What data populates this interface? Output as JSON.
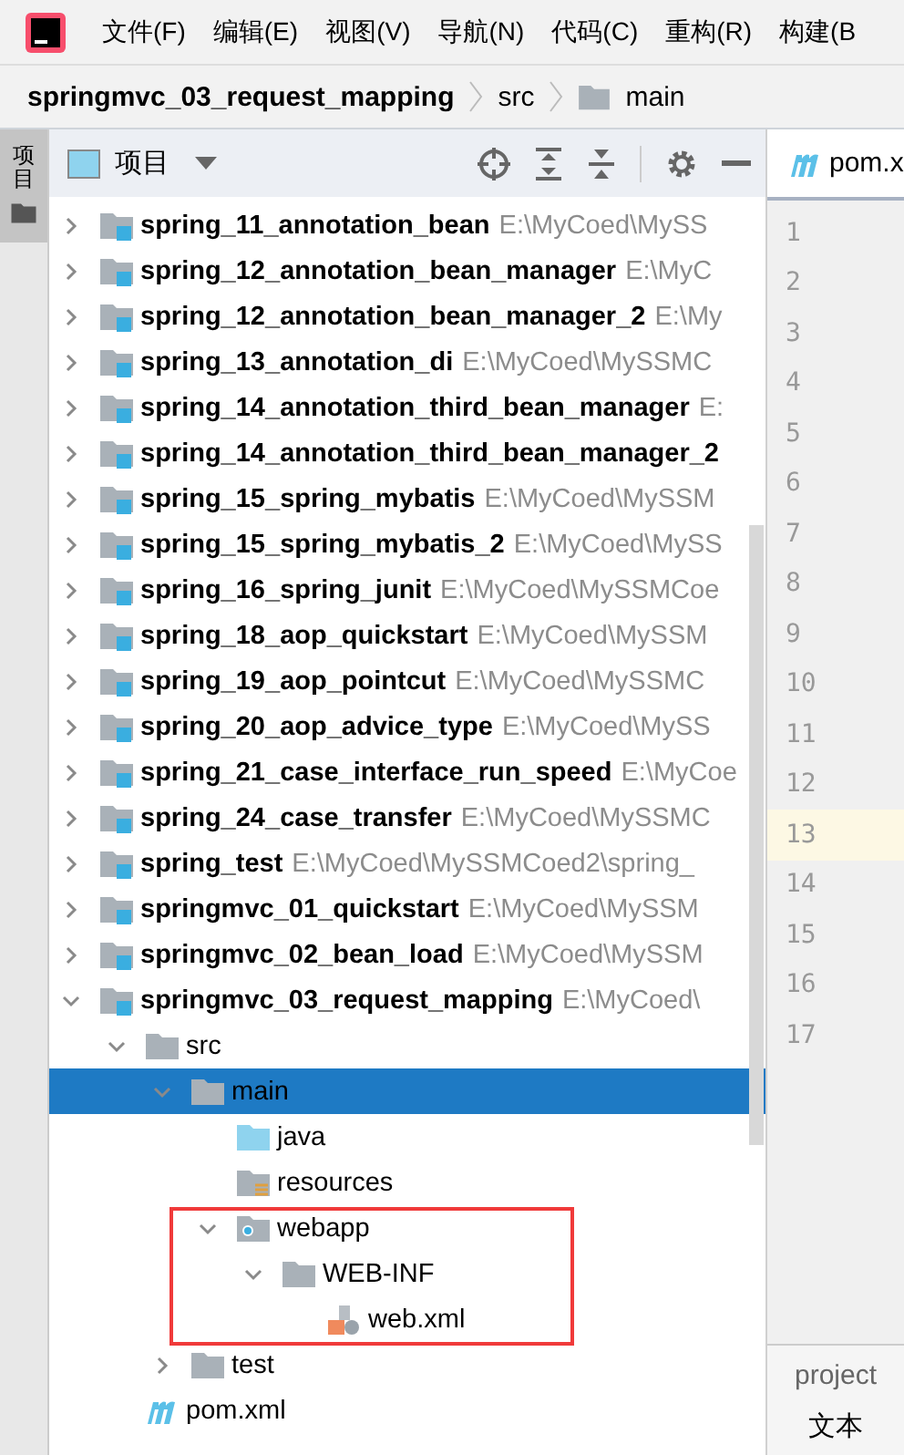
{
  "menu_bar": {
    "items": [
      "文件(F)",
      "编辑(E)",
      "视图(V)",
      "导航(N)",
      "代码(C)",
      "重构(R)",
      "构建(B"
    ]
  },
  "breadcrumb": [
    {
      "label": "springmvc_03_request_mapping",
      "kind": "project"
    },
    {
      "label": "src",
      "kind": "plain"
    },
    {
      "label": "main",
      "kind": "folder"
    }
  ],
  "side_stripe": {
    "label": "项目",
    "selected": true
  },
  "project_panel": {
    "title": "项目",
    "tree": [
      {
        "label": "spring_11_annotation_bean",
        "path": "E:\\MyCoed\\MySS",
        "kind": "module",
        "expanded": false
      },
      {
        "label": "spring_12_annotation_bean_manager",
        "path": "E:\\MyC",
        "kind": "module",
        "expanded": false
      },
      {
        "label": "spring_12_annotation_bean_manager_2",
        "path": "E:\\My",
        "kind": "module",
        "expanded": false
      },
      {
        "label": "spring_13_annotation_di",
        "path": "E:\\MyCoed\\MySSMC",
        "kind": "module",
        "expanded": false
      },
      {
        "label": "spring_14_annotation_third_bean_manager",
        "path": "E:",
        "kind": "module",
        "expanded": false
      },
      {
        "label": "spring_14_annotation_third_bean_manager_2",
        "kind": "module",
        "expanded": false
      },
      {
        "label": "spring_15_spring_mybatis",
        "path": "E:\\MyCoed\\MySSM",
        "kind": "module",
        "expanded": false
      },
      {
        "label": "spring_15_spring_mybatis_2",
        "path": "E:\\MyCoed\\MySS",
        "kind": "module",
        "expanded": false
      },
      {
        "label": "spring_16_spring_junit",
        "path": "E:\\MyCoed\\MySSMCoe",
        "kind": "module",
        "expanded": false
      },
      {
        "label": "spring_18_aop_quickstart",
        "path": "E:\\MyCoed\\MySSM",
        "kind": "module",
        "expanded": false
      },
      {
        "label": "spring_19_aop_pointcut",
        "path": "E:\\MyCoed\\MySSMC",
        "kind": "module",
        "expanded": false
      },
      {
        "label": "spring_20_aop_advice_type",
        "path": "E:\\MyCoed\\MySS",
        "kind": "module",
        "expanded": false
      },
      {
        "label": "spring_21_case_interface_run_speed",
        "path": "E:\\MyCoe",
        "kind": "module",
        "expanded": false
      },
      {
        "label": "spring_24_case_transfer",
        "path": "E:\\MyCoed\\MySSMC",
        "kind": "module",
        "expanded": false
      },
      {
        "label": "spring_test",
        "path": "E:\\MyCoed\\MySSMCoed2\\spring_",
        "kind": "module",
        "expanded": false
      },
      {
        "label": "springmvc_01_quickstart",
        "path": "E:\\MyCoed\\MySSM",
        "kind": "module",
        "expanded": false
      },
      {
        "label": "springmvc_02_bean_load",
        "path": "E:\\MyCoed\\MySSM",
        "kind": "module",
        "expanded": false
      },
      {
        "label": "springmvc_03_request_mapping",
        "path": "E:\\MyCoed\\",
        "kind": "module",
        "expanded": true,
        "children": [
          {
            "label": "src",
            "kind": "folder",
            "expanded": true,
            "children": [
              {
                "label": "main",
                "kind": "folder",
                "expanded": true,
                "selected": true,
                "children": [
                  {
                    "label": "java",
                    "kind": "source-folder",
                    "selected": false
                  },
                  {
                    "label": "resources",
                    "kind": "resource-folder",
                    "selected": false
                  },
                  {
                    "label": "webapp",
                    "kind": "web-folder",
                    "expanded": true,
                    "annotated": true,
                    "selected": false,
                    "children": [
                      {
                        "label": "WEB-INF",
                        "kind": "folder",
                        "expanded": true,
                        "selected": false,
                        "children": [
                          {
                            "label": "web.xml",
                            "kind": "xml-file",
                            "selected": false
                          }
                        ]
                      }
                    ]
                  }
                ]
              },
              {
                "label": "test",
                "kind": "folder",
                "expanded": false,
                "selected": false
              }
            ]
          },
          {
            "label": "pom.xml",
            "kind": "maven-file",
            "selected": false
          }
        ]
      }
    ]
  },
  "editor": {
    "tab": "pom.x",
    "lines": [
      {
        "number": "1",
        "current": false
      },
      {
        "number": "2",
        "current": false
      },
      {
        "number": "3",
        "current": false
      },
      {
        "number": "4",
        "current": false
      },
      {
        "number": "5",
        "current": false
      },
      {
        "number": "6",
        "current": false
      },
      {
        "number": "7",
        "current": false
      },
      {
        "number": "8",
        "current": false
      },
      {
        "number": "9",
        "current": false
      },
      {
        "number": "10",
        "current": false
      },
      {
        "number": "11",
        "current": false
      },
      {
        "number": "12",
        "current": false
      },
      {
        "number": "13",
        "current": true
      },
      {
        "number": "14",
        "current": false
      },
      {
        "number": "15",
        "current": false
      },
      {
        "number": "16",
        "current": false
      },
      {
        "number": "17",
        "current": false
      }
    ]
  },
  "structure_panel": {
    "items": [
      "project",
      "文本"
    ]
  }
}
